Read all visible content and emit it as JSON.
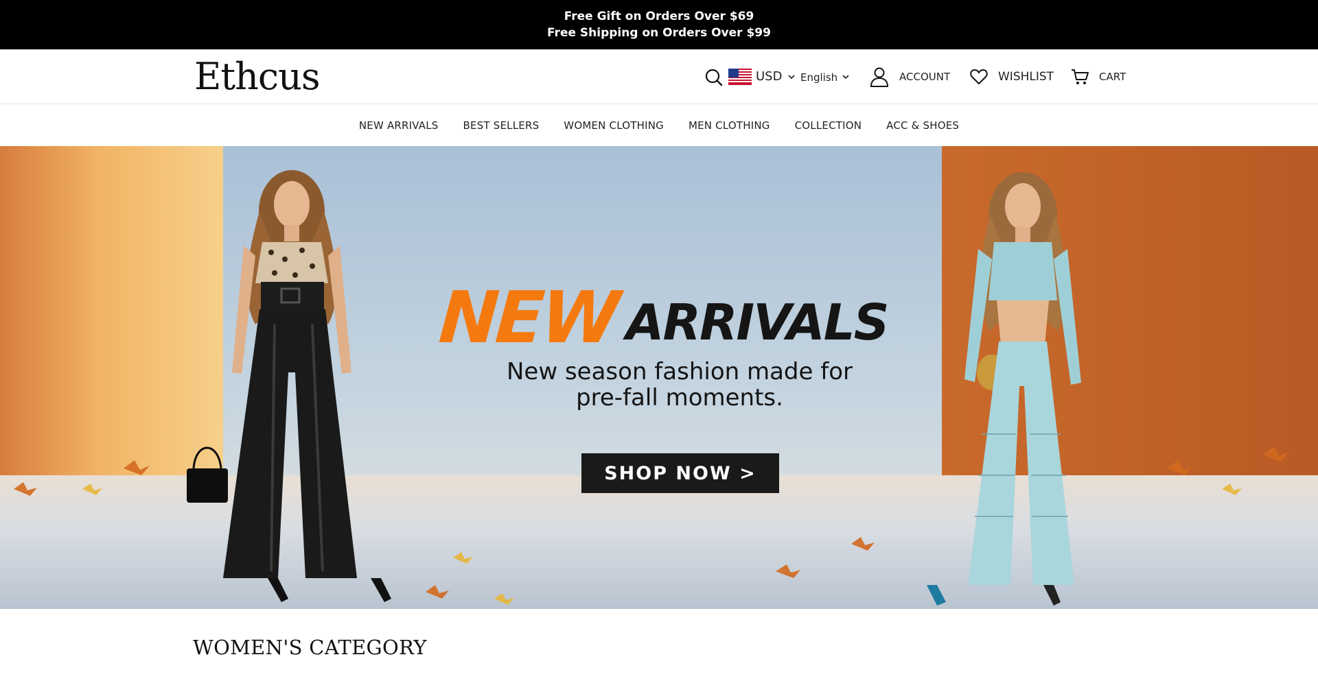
{
  "announcement": {
    "line1": "Free Gift on Orders Over $69",
    "line2": "Free Shipping on Orders Over $99"
  },
  "header": {
    "logo_text": "Ethcus",
    "currency": "USD",
    "language": "English",
    "account_label": "ACCOUNT",
    "wishlist_label": "WISHLIST",
    "cart_label": "CART",
    "icons": [
      "search-icon",
      "us-flag-icon",
      "chevron-down-icon",
      "account-icon",
      "heart-icon",
      "cart-icon"
    ]
  },
  "nav": {
    "items": [
      {
        "label": "NEW ARRIVALS"
      },
      {
        "label": "BEST SELLERS"
      },
      {
        "label": "WOMEN CLOTHING"
      },
      {
        "label": "MEN CLOTHING"
      },
      {
        "label": "COLLECTION"
      },
      {
        "label": "ACC & SHOES"
      }
    ]
  },
  "hero": {
    "title_accent": "NEW",
    "title_main": "ARRIVALS",
    "subtitle_line1": "New season fashion made for",
    "subtitle_line2": "pre-fall moments.",
    "cta_label": "SHOP NOW >",
    "colors": {
      "accent": "#f47a10",
      "button_bg": "#1a1a1a",
      "wall_left": "#d9803a",
      "wall_right": "#c96a2a",
      "sky": "#b7cbdc"
    }
  },
  "section": {
    "title": "WOMEN'S CATEGORY"
  }
}
